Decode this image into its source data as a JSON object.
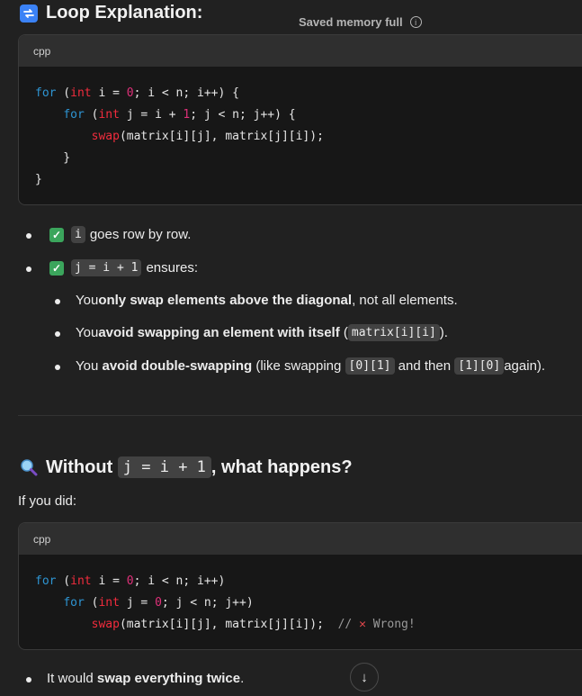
{
  "header": {
    "title": "Loop Explanation:",
    "saved_memory": "Saved memory full",
    "info_symbol": "i"
  },
  "code1": {
    "lang": "cpp",
    "lines": [
      [
        {
          "t": "for",
          "c": "kw"
        },
        {
          "t": " ("
        },
        {
          "t": "int",
          "c": "ty"
        },
        {
          "t": " i = "
        },
        {
          "t": "0",
          "c": "num"
        },
        {
          "t": "; i < n; i++) {"
        }
      ],
      [
        {
          "t": "    "
        },
        {
          "t": "for",
          "c": "kw"
        },
        {
          "t": " ("
        },
        {
          "t": "int",
          "c": "ty"
        },
        {
          "t": " j = i + "
        },
        {
          "t": "1",
          "c": "num"
        },
        {
          "t": "; j < n; j++) {"
        }
      ],
      [
        {
          "t": "        "
        },
        {
          "t": "swap",
          "c": "fn"
        },
        {
          "t": "(matrix[i][j], matrix[j][i]);"
        }
      ],
      [
        {
          "t": "    }"
        }
      ],
      [
        {
          "t": "}"
        }
      ]
    ]
  },
  "bullets": {
    "b1_code": "i",
    "b1_text": "goes row by row.",
    "b2_code": "j = i + 1",
    "b2_text": "ensures:",
    "s1_pre": "You ",
    "s1_bold": "only swap elements above the diagonal",
    "s1_post": ", not all elements.",
    "s2_pre": "You ",
    "s2_bold": "avoid swapping an element with itself",
    "s2_open": " (",
    "s2_code": "matrix[i][i]",
    "s2_close": ").",
    "s3_pre": "You ",
    "s3_bold": "avoid double-swapping",
    "s3_mid": " (like swapping ",
    "s3_code1": "[0][1]",
    "s3_and": " and then ",
    "s3_code2": "[1][0]",
    "s3_post": " again)."
  },
  "section2": {
    "title_pre": "Without ",
    "title_code": "j = i + 1",
    "title_post": ", what happens?",
    "intro": "If you did:"
  },
  "code2": {
    "lang": "cpp",
    "lines": [
      [
        {
          "t": "for",
          "c": "kw"
        },
        {
          "t": " ("
        },
        {
          "t": "int",
          "c": "ty"
        },
        {
          "t": " i = "
        },
        {
          "t": "0",
          "c": "num"
        },
        {
          "t": "; i < n; i++)"
        }
      ],
      [
        {
          "t": "    "
        },
        {
          "t": "for",
          "c": "kw"
        },
        {
          "t": " ("
        },
        {
          "t": "int",
          "c": "ty"
        },
        {
          "t": " j = "
        },
        {
          "t": "0",
          "c": "num"
        },
        {
          "t": "; j < n; j++)"
        }
      ],
      [
        {
          "t": "        "
        },
        {
          "t": "swap",
          "c": "fn"
        },
        {
          "t": "(matrix[i][j], matrix[j][i]);  "
        },
        {
          "t": "// ",
          "c": "cm"
        },
        {
          "t": "✕",
          "c": "x"
        },
        {
          "t": " Wrong!",
          "c": "cm"
        }
      ]
    ]
  },
  "last_bullet": {
    "pre": "It would ",
    "bold": "swap everything twice",
    "post": "."
  },
  "scroll_symbol": "↓"
}
